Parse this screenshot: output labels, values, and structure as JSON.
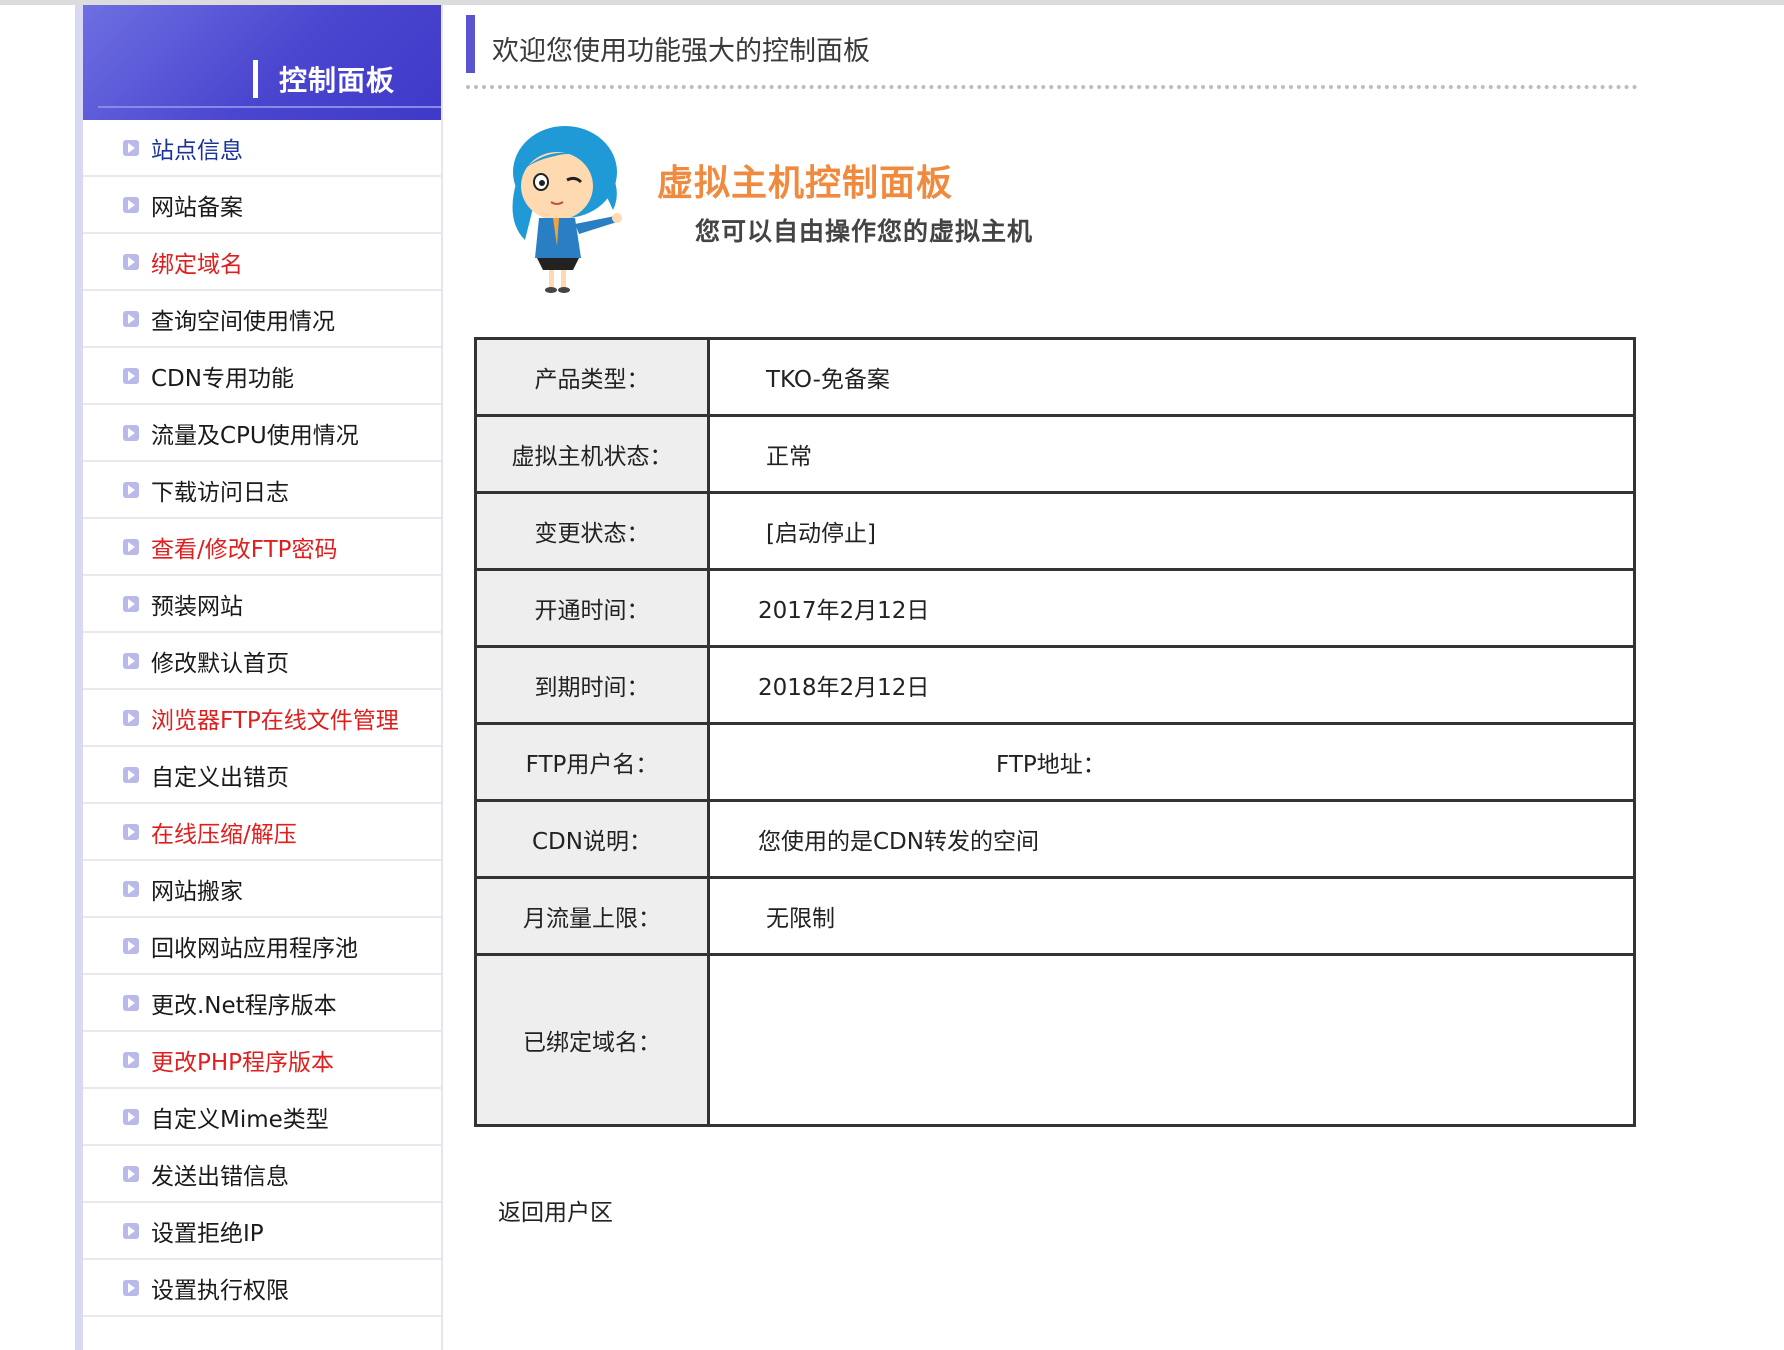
{
  "sidebar": {
    "title": "控制面板",
    "items": [
      {
        "label": "站点信息",
        "style": "blue"
      },
      {
        "label": "网站备案",
        "style": "normal"
      },
      {
        "label": "绑定域名",
        "style": "red"
      },
      {
        "label": "查询空间使用情况",
        "style": "normal"
      },
      {
        "label": "CDN专用功能",
        "style": "normal"
      },
      {
        "label": "流量及CPU使用情况",
        "style": "normal"
      },
      {
        "label": "下载访问日志",
        "style": "normal"
      },
      {
        "label": "查看/修改FTP密码",
        "style": "red"
      },
      {
        "label": "预装网站",
        "style": "normal"
      },
      {
        "label": "修改默认首页",
        "style": "normal"
      },
      {
        "label": "浏览器FTP在线文件管理",
        "style": "red"
      },
      {
        "label": "自定义出错页",
        "style": "normal"
      },
      {
        "label": "在线压缩/解压",
        "style": "red"
      },
      {
        "label": "网站搬家",
        "style": "normal"
      },
      {
        "label": "回收网站应用程序池",
        "style": "normal"
      },
      {
        "label": "更改.Net程序版本",
        "style": "normal"
      },
      {
        "label": "更改PHP程序版本",
        "style": "red"
      },
      {
        "label": "自定义Mime类型",
        "style": "normal"
      },
      {
        "label": "发送出错信息",
        "style": "normal"
      },
      {
        "label": "设置拒绝IP",
        "style": "normal"
      },
      {
        "label": "设置执行权限",
        "style": "normal"
      }
    ]
  },
  "header": {
    "welcome": "欢迎您使用功能强大的控制面板"
  },
  "banner": {
    "title": "虚拟主机控制面板",
    "subtitle": "您可以自由操作您的虚拟主机"
  },
  "info": {
    "product_type_label": "产品类型：",
    "product_type": "TKO-免备案",
    "status_label": "虚拟主机状态：",
    "status": "正常",
    "change_label": "变更状态：",
    "change": "[启动停止]",
    "open_label": "开通时间：",
    "open": "2017年2月12日",
    "expire_label": "到期时间：",
    "expire": "2018年2月12日",
    "ftp_user_label": "FTP用户名：",
    "ftp_user": "",
    "ftp_addr_label": "FTP地址：",
    "ftp_addr": "",
    "cdn_label": "CDN说明：",
    "cdn": "您使用的是CDN转发的空间",
    "traffic_label": "月流量上限：",
    "traffic": "无限制",
    "domains_label": "已绑定域名：",
    "domains": ""
  },
  "footer": {
    "back_link": "返回用户区"
  },
  "colors": {
    "accent": "#4b46cf",
    "link_blue": "#1a3399",
    "link_red": "#e01e1e",
    "banner_orange": "#f08a3e"
  }
}
